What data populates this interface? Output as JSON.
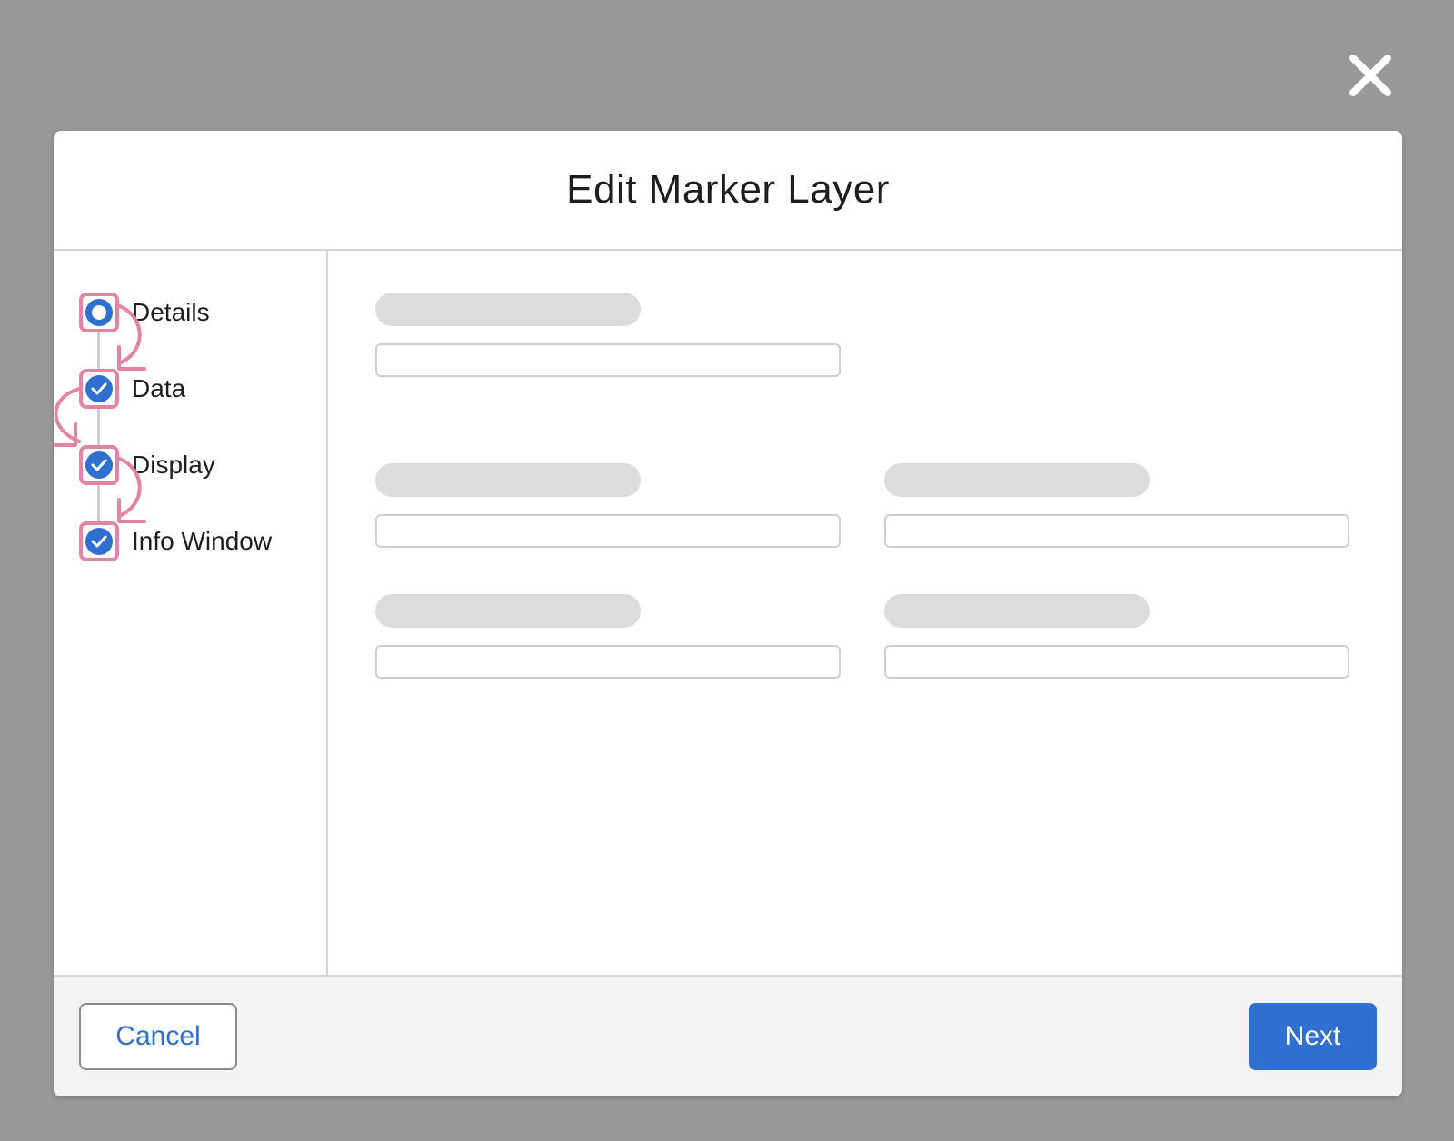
{
  "modal": {
    "title": "Edit Marker Layer"
  },
  "icons": {
    "close": "close-icon",
    "step_complete": "check-icon",
    "step_current": "current-step-icon",
    "annotation": "curved-arrow-icon"
  },
  "steps": [
    {
      "label": "Details",
      "state": "current"
    },
    {
      "label": "Data",
      "state": "complete"
    },
    {
      "label": "Display",
      "state": "complete"
    },
    {
      "label": "Info Window",
      "state": "complete"
    }
  ],
  "footer": {
    "cancel_label": "Cancel",
    "next_label": "Next"
  },
  "colors": {
    "overlay": "#989898",
    "accent": "#2f6fd0",
    "annotation": "#e284a4",
    "skeleton": "#dcdcdc"
  }
}
